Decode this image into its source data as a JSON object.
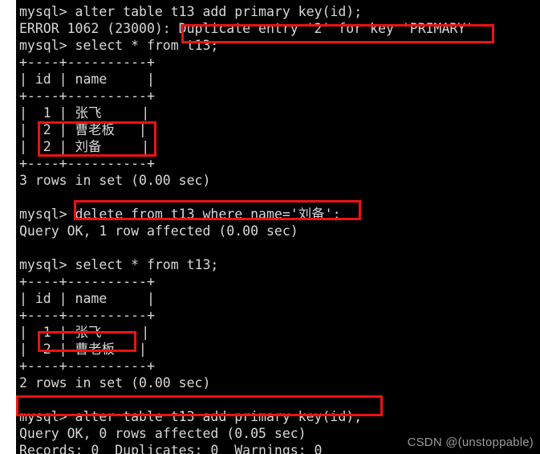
{
  "window": {
    "type": "terminal",
    "background_color": "#000000",
    "text_color": "#d8d8d8",
    "highlight_color": "#ee1111",
    "left_gutter_color": "#ffffff"
  },
  "terminal": {
    "lines": [
      {
        "id": "l1",
        "text": "mysql> alter table t13 add primary key(id);"
      },
      {
        "id": "l2",
        "text": "ERROR 1062 (23000): Duplicate entry '2' for key 'PRIMARY'"
      },
      {
        "id": "l3",
        "text": "mysql> select * from t13;"
      },
      {
        "id": "l4",
        "text": "+----+----------+"
      },
      {
        "id": "l5",
        "text": "| id | name     |"
      },
      {
        "id": "l6",
        "text": "+----+----------+"
      },
      {
        "id": "l7",
        "text": "|  1 | 张飞     |"
      },
      {
        "id": "l8",
        "text": "|  2 | 曹老板   |"
      },
      {
        "id": "l9",
        "text": "|  2 | 刘备     |"
      },
      {
        "id": "l10",
        "text": "+----+----------+"
      },
      {
        "id": "l11",
        "text": "3 rows in set (0.00 sec)"
      },
      {
        "id": "l12",
        "text": ""
      },
      {
        "id": "l13",
        "text": "mysql> delete from t13 where name='刘备';"
      },
      {
        "id": "l14",
        "text": "Query OK, 1 row affected (0.00 sec)"
      },
      {
        "id": "l15",
        "text": ""
      },
      {
        "id": "l16",
        "text": "mysql> select * from t13;"
      },
      {
        "id": "l17",
        "text": "+----+----------+"
      },
      {
        "id": "l18",
        "text": "| id | name     |"
      },
      {
        "id": "l19",
        "text": "+----+----------+"
      },
      {
        "id": "l20",
        "text": "|  1 | 张飞     |"
      },
      {
        "id": "l21",
        "text": "|  2 | 曹老板   |"
      },
      {
        "id": "l22",
        "text": "+----+----------+"
      },
      {
        "id": "l23",
        "text": "2 rows in set (0.00 sec)"
      },
      {
        "id": "l24",
        "text": ""
      },
      {
        "id": "l25",
        "text": "mysql> alter table t13 add primary key(id);"
      },
      {
        "id": "l26",
        "text": "Query OK, 0 rows affected (0.05 sec)"
      },
      {
        "id": "l27",
        "text": "Records: 0  Duplicates: 0  Warnings: 0"
      }
    ]
  },
  "sql_session": {
    "prompt": "mysql>",
    "statements": [
      {
        "command": "alter table t13 add primary key(id);",
        "result": "ERROR 1062 (23000): Duplicate entry '2' for key 'PRIMARY'",
        "status": "error",
        "error_code": "1062",
        "sqlstate": "23000"
      },
      {
        "command": "select * from t13;",
        "result": "3 rows in set (0.00 sec)",
        "status": "ok",
        "table": {
          "columns": [
            "id",
            "name"
          ],
          "rows": [
            [
              "1",
              "张飞"
            ],
            [
              "2",
              "曹老板"
            ],
            [
              "2",
              "刘备"
            ]
          ],
          "row_count": "3",
          "duration": "0.00 sec"
        }
      },
      {
        "command": "delete from t13 where name='刘备';",
        "result": "Query OK, 1 row affected (0.00 sec)",
        "status": "ok",
        "rows_affected": "1",
        "duration": "0.00 sec"
      },
      {
        "command": "select * from t13;",
        "result": "2 rows in set (0.00 sec)",
        "status": "ok",
        "table": {
          "columns": [
            "id",
            "name"
          ],
          "rows": [
            [
              "1",
              "张飞"
            ],
            [
              "2",
              "曹老板"
            ]
          ],
          "row_count": "2",
          "duration": "0.00 sec"
        }
      },
      {
        "command": "alter table t13 add primary key(id);",
        "result": "Query OK, 0 rows affected (0.05 sec)",
        "status": "ok",
        "rows_affected": "0",
        "duration": "0.05 sec",
        "extra": "Records: 0  Duplicates: 0  Warnings: 0"
      }
    ]
  },
  "annotations": [
    {
      "id": "a1",
      "label": "duplicate-entry-error",
      "target_text": "Duplicate entry '2' for key 'PRIMARY'"
    },
    {
      "id": "a2",
      "label": "duplicate-id-rows",
      "target_text": "|  2 | 曹老板   |  /  |  2 | 刘备     |"
    },
    {
      "id": "a3",
      "label": "delete-statement",
      "target_text": "delete from t13 where name='刘备';"
    },
    {
      "id": "a4",
      "label": "remaining-row",
      "target_text": "|  2 | 曹老板   |"
    },
    {
      "id": "a5",
      "label": "successful-alter-statement",
      "target_text": "mysql> alter table t13 add primary key(id);"
    }
  ],
  "watermark": {
    "text": "CSDN @(unstoppable)"
  }
}
